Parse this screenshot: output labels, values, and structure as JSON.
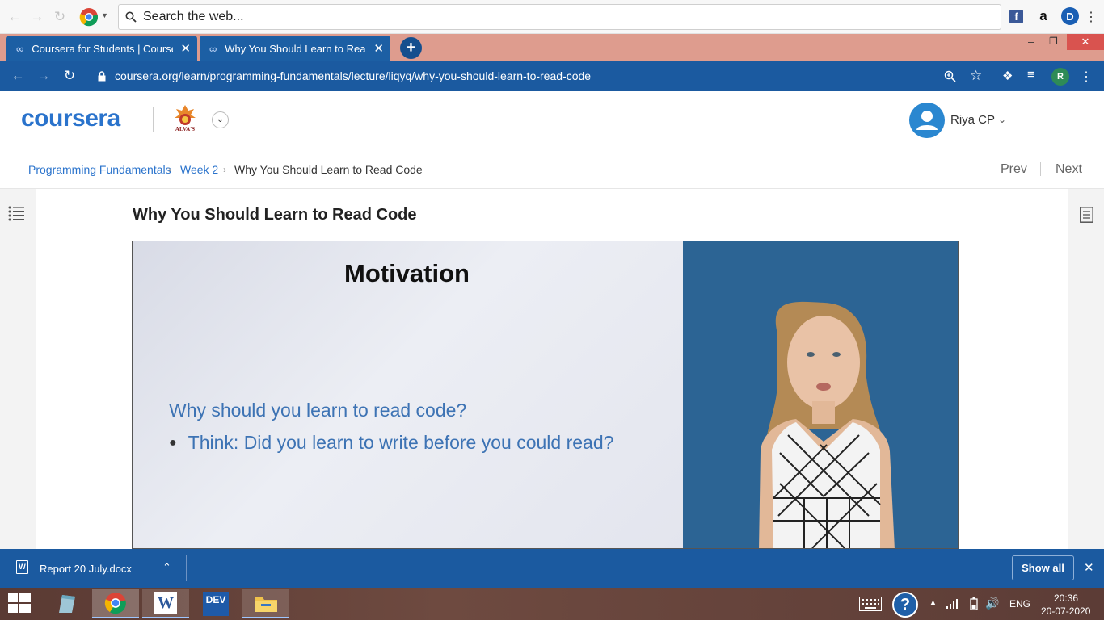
{
  "top_search": {
    "placeholder": "Search the web..."
  },
  "tabs": [
    {
      "label": "Coursera for Students | Coursera"
    },
    {
      "label": "Why You Should Learn to Read C"
    }
  ],
  "address": {
    "url": "coursera.org/learn/programming-fundamentals/lecture/liqyq/why-you-should-learn-to-read-code"
  },
  "profile_initial": "R",
  "header": {
    "logo_text": "coursera",
    "partner_logo_text": "ALVA'S",
    "user_name": "Riya CP"
  },
  "breadcrumb": {
    "items": [
      "Programming Fundamentals",
      "Week 2",
      "Why You Should Learn to Read Code"
    ],
    "prev": "Prev",
    "next": "Next"
  },
  "lecture": {
    "title": "Why You Should Learn to Read Code",
    "slide_title": "Motivation",
    "slide_question": "Why should you learn to read code?",
    "slide_bullet": "Think: Did you learn to write before you could read?"
  },
  "downloads": {
    "file_name": "Report 20 July.docx",
    "show_all": "Show all"
  },
  "taskbar": {
    "dev_label": "DEV",
    "lang": "ENG",
    "time": "20:36",
    "date": "20-07-2020"
  },
  "colors": {
    "accent": "#1b5aa0",
    "tab_strip": "#de9c8e",
    "coursera_blue": "#2a73cc",
    "slide_text": "#3d73b4",
    "video_right_bg": "#2c6494"
  }
}
